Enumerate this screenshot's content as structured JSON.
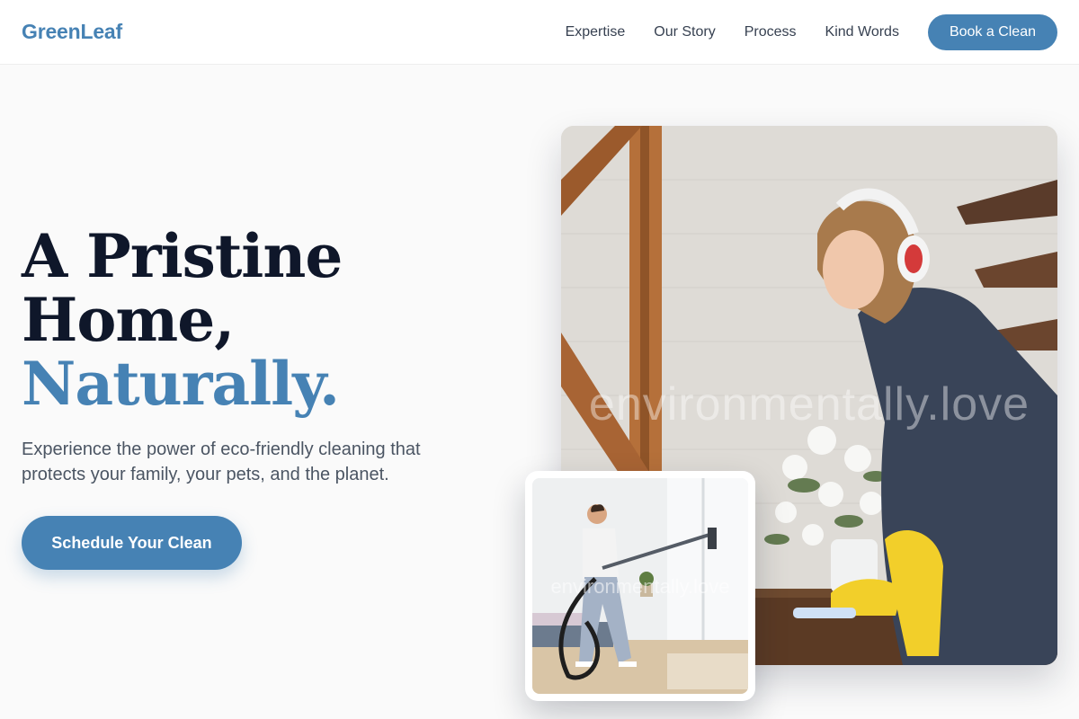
{
  "brand": {
    "name": "GreenLeaf",
    "accent_color": "#4682b4"
  },
  "nav": {
    "links": [
      "Expertise",
      "Our Story",
      "Process",
      "Kind Words"
    ],
    "cta_label": "Book a Clean"
  },
  "hero": {
    "title_line1": "A Pristine",
    "title_line2": "Home,",
    "title_accent": "Naturally.",
    "subtitle": "Experience the power of eco-friendly cleaning that protects your family, your pets, and the planet.",
    "cta_label": "Schedule Your Clean"
  },
  "images": {
    "main": {
      "depicts": "woman-cleaning-table",
      "watermark": "environmentally.love"
    },
    "inset": {
      "depicts": "man-dancing-with-vacuum",
      "watermark": "environmentally.love"
    }
  }
}
